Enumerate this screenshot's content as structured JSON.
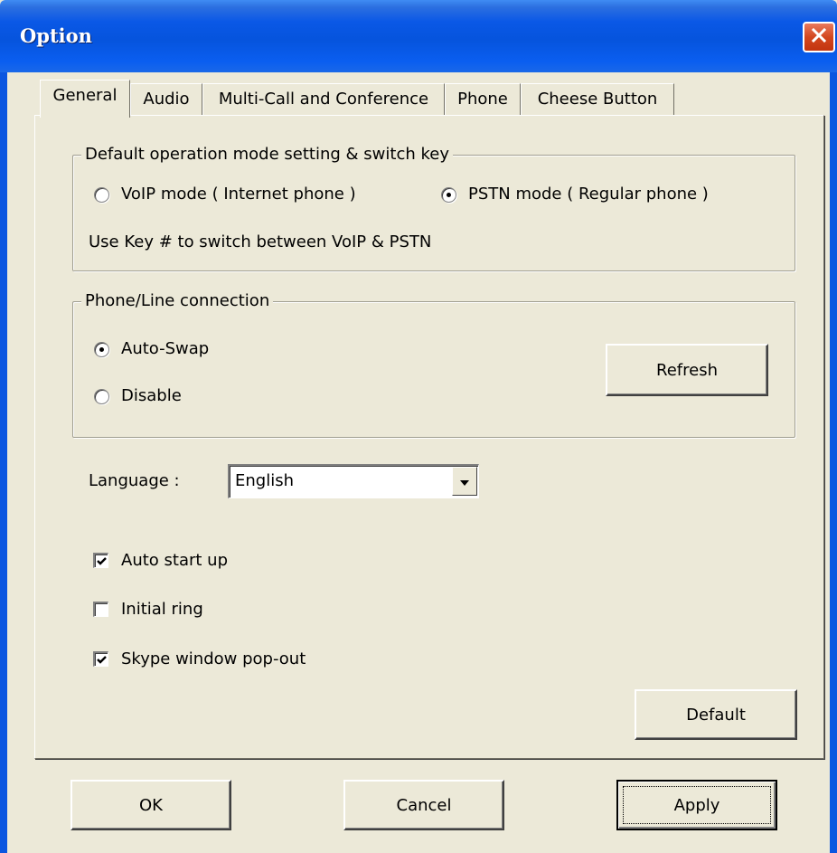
{
  "window": {
    "title": "Option"
  },
  "tabs": [
    {
      "label": "General",
      "active": true
    },
    {
      "label": "Audio",
      "active": false
    },
    {
      "label": "Multi-Call and Conference",
      "active": false
    },
    {
      "label": "Phone",
      "active": false
    },
    {
      "label": "Cheese Button",
      "active": false
    }
  ],
  "mode_group": {
    "legend": "Default operation mode setting & switch key",
    "voip_label": "VoIP mode ( Internet phone )",
    "voip_selected": false,
    "pstn_label": "PSTN mode ( Regular phone )",
    "pstn_selected": true,
    "hint": "Use Key # to switch between VoIP & PSTN"
  },
  "connection_group": {
    "legend": "Phone/Line connection",
    "autoswap_label": "Auto-Swap",
    "autoswap_selected": true,
    "disable_label": "Disable",
    "disable_selected": false,
    "refresh_label": "Refresh"
  },
  "language": {
    "label": "Language :",
    "value": "English"
  },
  "checkboxes": [
    {
      "label": "Auto start up",
      "checked": true
    },
    {
      "label": "Initial ring",
      "checked": false
    },
    {
      "label": "Skype window pop-out",
      "checked": true
    }
  ],
  "default_button": "Default",
  "footer": {
    "ok_label": "OK",
    "cancel_label": "Cancel",
    "apply_label": "Apply"
  },
  "icons": {
    "close": "close-icon",
    "dropdown": "chevron-down-icon",
    "check": "check-icon"
  },
  "colors": {
    "titlebar": "#0a58e6",
    "close_button": "#d3471f",
    "dialog_background": "#ece9d8"
  }
}
